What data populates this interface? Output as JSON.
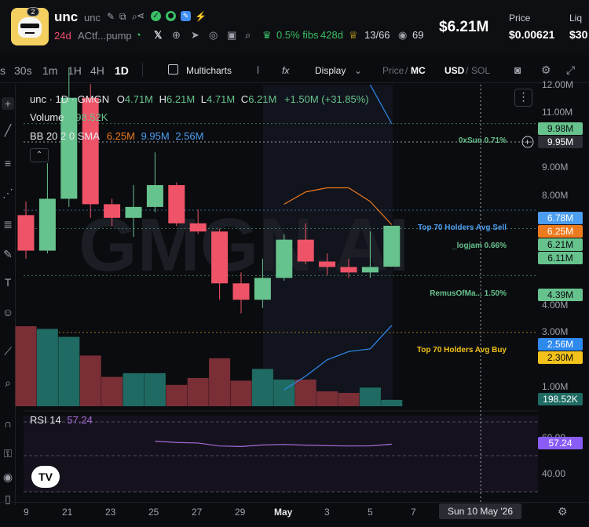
{
  "header": {
    "avatar_badge": "2",
    "ticker": "unc",
    "name": "unc",
    "age": "24d",
    "contract": "ACtf...pump",
    "fibs_pct": "0.5% fibs",
    "fibs_age": "428d",
    "holders_top": "13/66",
    "watchers": "69",
    "market_cap": "$6.21M",
    "price_label": "Price",
    "price": "$0.00621",
    "liq_label": "Liq",
    "liq": "$30"
  },
  "toolbar": {
    "timeframes": [
      "s",
      "30s",
      "1m",
      "1H",
      "4H",
      "1D"
    ],
    "active_timeframe": "1D",
    "multicharts": "Multicharts",
    "fx": "fx",
    "display": "Display",
    "price_mc_price": "Price",
    "price_mc_sep": "/",
    "price_mc_mc": "MC",
    "usd_sol_usd": "USD",
    "usd_sol_sep": "/",
    "usd_sol_sol": "SOL"
  },
  "legend": {
    "title": "unc · 1D · GMGN",
    "o_label": "O",
    "o": "4.71M",
    "h_label": "H",
    "h": "6.21M",
    "l_label": "L",
    "l": "4.71M",
    "c_label": "C",
    "c": "6.21M",
    "change": "+1.50M (+31.85%)",
    "volume_label": "Volume",
    "volume": "198.52K",
    "bb_label": "BB 20 2 0 SMA",
    "bb_upper": "6.25M",
    "bb_mid": "9.95M",
    "bb_lower": "2.56M",
    "rsi_label": "RSI 14",
    "rsi": "57.24"
  },
  "watermark": "GMGN.AI",
  "price_axis": [
    "12.00M",
    "11.00M",
    "10.00M",
    "9.00M",
    "8.00M",
    "7.00M",
    "6.00M",
    "5.00M",
    "4.00M",
    "3.00M",
    "2.00M",
    "1.00M"
  ],
  "rsi_axis": [
    "60.00",
    "40.00"
  ],
  "price_tags": [
    {
      "value": "9.98M",
      "bg": "#67c38d",
      "fg": "#0b0c0f"
    },
    {
      "value": "9.95M",
      "bg": "#2b2e35",
      "fg": "#ffffff"
    },
    {
      "value": "6.78M",
      "bg": "#4d9ef0",
      "fg": "#ffffff"
    },
    {
      "value": "6.25M",
      "bg": "#ee7a1e",
      "fg": "#ffffff"
    },
    {
      "value": "6.21M",
      "bg": "#67c38d",
      "fg": "#0b0c0f"
    },
    {
      "value": "6.11M",
      "bg": "#67c38d",
      "fg": "#0b0c0f"
    },
    {
      "value": "4.39M",
      "bg": "#67c38d",
      "fg": "#0b0c0f"
    },
    {
      "value": "2.56M",
      "bg": "#2f8af0",
      "fg": "#ffffff"
    },
    {
      "value": "2.30M",
      "bg": "#f2c21b",
      "fg": "#0b0c0f"
    },
    {
      "value": "198.52K",
      "bg": "#1f6b63",
      "fg": "#ffffff"
    },
    {
      "value": "57.24",
      "bg": "#8a5cf6",
      "fg": "#ffffff"
    }
  ],
  "annotations": [
    {
      "text": "0xSun 0.71%",
      "color": "#67c38d",
      "price": 9.95
    },
    {
      "text": "Top 70 Holders Avg Sell",
      "color": "#4d9ef0",
      "price": 6.78
    },
    {
      "text": "_logjam 0.66%",
      "color": "#67c38d",
      "price": 6.11
    },
    {
      "text": "RemusOfMa... 1.50%",
      "color": "#67c38d",
      "price": 4.39
    },
    {
      "text": "Top 70 Holders Avg Buy",
      "color": "#f2c21b",
      "price": 2.3
    }
  ],
  "x_axis": [
    "9",
    "21",
    "23",
    "25",
    "27",
    "29",
    "May",
    "3",
    "5",
    "7"
  ],
  "crosshair_date": "Sun 10 May '26",
  "colors": {
    "up": "#67c38d",
    "down": "#ef5367",
    "vol_up": "#1f6b63",
    "vol_down": "#7a2e36",
    "bb_upper": "#ee7a1e",
    "bb_lower": "#2f8af0",
    "rsi": "#a56bd8"
  },
  "chart_data": {
    "type": "candlestick",
    "candles": [
      {
        "o": 6.6,
        "h": 7.1,
        "l": 5.0,
        "c": 5.3
      },
      {
        "o": 5.3,
        "h": 8.5,
        "l": 5.2,
        "c": 7.2
      },
      {
        "o": 7.2,
        "h": 12.0,
        "l": 6.9,
        "c": 10.9
      },
      {
        "o": 10.9,
        "h": 11.4,
        "l": 6.5,
        "c": 7.0
      },
      {
        "o": 7.0,
        "h": 7.2,
        "l": 6.2,
        "c": 6.5
      },
      {
        "o": 6.5,
        "h": 7.7,
        "l": 5.8,
        "c": 6.9
      },
      {
        "o": 6.9,
        "h": 8.9,
        "l": 6.7,
        "c": 7.7
      },
      {
        "o": 7.7,
        "h": 7.8,
        "l": 6.2,
        "c": 6.3
      },
      {
        "o": 6.3,
        "h": 6.8,
        "l": 5.9,
        "c": 6.0
      },
      {
        "o": 6.0,
        "h": 6.1,
        "l": 3.5,
        "c": 4.1
      },
      {
        "o": 4.1,
        "h": 4.5,
        "l": 3.0,
        "c": 3.5
      },
      {
        "o": 3.5,
        "h": 5.0,
        "l": 3.2,
        "c": 4.3
      },
      {
        "o": 4.3,
        "h": 5.9,
        "l": 4.2,
        "c": 5.7
      },
      {
        "o": 5.7,
        "h": 6.3,
        "l": 4.8,
        "c": 4.9
      },
      {
        "o": 4.9,
        "h": 5.2,
        "l": 4.4,
        "c": 4.7
      },
      {
        "o": 4.7,
        "h": 5.0,
        "l": 4.3,
        "c": 4.5
      },
      {
        "o": 4.5,
        "h": 6.0,
        "l": 4.3,
        "c": 4.7
      },
      {
        "o": 4.71,
        "h": 6.21,
        "l": 4.71,
        "c": 6.21
      }
    ],
    "volume": [
      1.5,
      1.45,
      1.3,
      0.95,
      0.55,
      0.62,
      0.62,
      0.4,
      0.53,
      0.9,
      0.48,
      0.7,
      0.5,
      0.5,
      0.28,
      0.25,
      0.35,
      0.12
    ],
    "bb_upper": [
      null,
      null,
      null,
      null,
      null,
      null,
      null,
      null,
      null,
      null,
      null,
      null,
      7.0,
      7.45,
      7.6,
      7.6,
      7.1,
      6.25
    ],
    "bb_lower": [
      null,
      null,
      null,
      null,
      null,
      null,
      null,
      null,
      null,
      null,
      null,
      null,
      0.2,
      0.7,
      1.3,
      1.6,
      1.7,
      2.56
    ],
    "rsi": [
      null,
      null,
      null,
      null,
      null,
      null,
      59.0,
      58.2,
      57.9,
      56.2,
      55.9,
      56.8,
      57.1,
      56.7,
      56.4,
      56.2,
      56.3,
      57.24
    ],
    "price_ylim": [
      0,
      12
    ],
    "rsi_ylim": [
      30,
      70
    ]
  }
}
